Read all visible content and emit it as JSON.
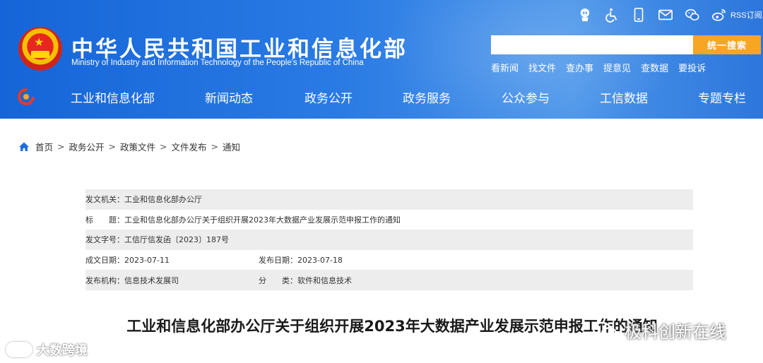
{
  "header": {
    "title": "中华人民共和国工业和信息化部",
    "subtitle": "Ministry of Industry and Information Technology of the People's Republic of China",
    "top_icons": [
      "robot-icon",
      "accessibility-icon",
      "mobile-icon",
      "mail-icon",
      "wechat-icon",
      "weibo-icon"
    ],
    "rss_label": "RSS订阅",
    "search": {
      "placeholder": "",
      "button_label": "统一搜索"
    },
    "quick_links": [
      "看新闻",
      "找文件",
      "查办事",
      "提意见",
      "查数据",
      "要投诉"
    ],
    "colors": {
      "header_blue": "#1e6fe0",
      "search_button": "#f6a623"
    }
  },
  "nav": {
    "items": [
      "工业和信息化部",
      "新闻动态",
      "政务公开",
      "政务服务",
      "公众参与",
      "工信数据",
      "专题专栏"
    ]
  },
  "breadcrumb": {
    "items": [
      "首页",
      "政务公开",
      "政策文件",
      "文件发布",
      "通知"
    ],
    "separator": ">"
  },
  "info": {
    "issuer_label": "发文机关：",
    "issuer": "工业和信息化部办公厅",
    "title_label": "标　　题：",
    "title": "工业和信息化部办公厅关于组织开展2023年大数据产业发展示范申报工作的通知",
    "doc_no_label": "发文字号：",
    "doc_no": "工信厅信发函〔2023〕187号",
    "created_label": "成文日期：",
    "created": "2023-07-11",
    "published_label": "发布日期：",
    "published": "2023-07-18",
    "org_label": "发布机构：",
    "org": "信息技术发展司",
    "category_label": "分　　类：",
    "category": "软件和信息技术"
  },
  "article": {
    "title": "工业和信息化部办公厅关于组织开展2023年大数据产业发展示范申报工作的通知"
  },
  "watermarks": {
    "left": "大数跨境",
    "right": "极科创新在线"
  }
}
